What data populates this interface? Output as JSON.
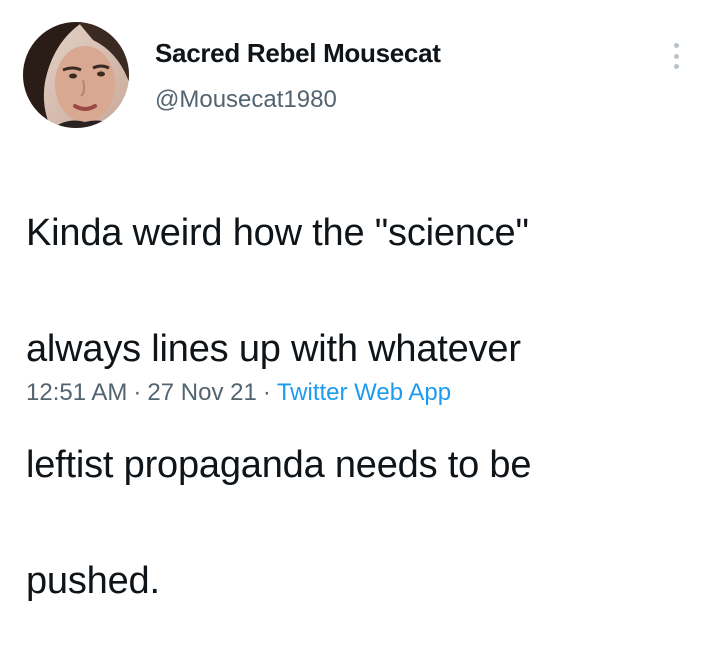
{
  "user": {
    "display_name": "Sacred Rebel Mousecat",
    "handle": "@Mousecat1980",
    "avatar_icon": "profile-photo"
  },
  "tweet": {
    "lines": [
      "Kinda weird how the \"science\"",
      "always lines up with whatever",
      "leftist propaganda needs to be",
      "pushed."
    ],
    "time": "12:51 AM",
    "date": "27 Nov 21",
    "separator": "·",
    "source": "Twitter Web App"
  },
  "menu": {
    "icon": "more-vertical-icon"
  },
  "colors": {
    "text": "#0f1419",
    "secondary": "#536471",
    "link": "#1d9bf0"
  }
}
